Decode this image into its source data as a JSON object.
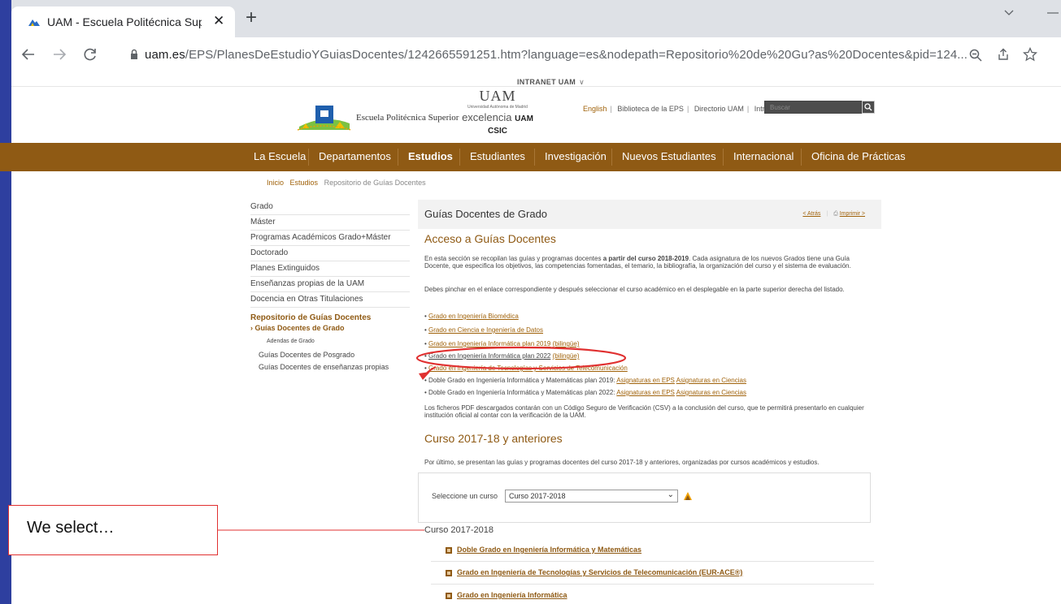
{
  "browser": {
    "tab_title": "UAM - Escuela Politécnica Superi",
    "tab_close": "✕",
    "new_tab": "+",
    "url_domain": "uam.es",
    "url_path": "/EPS/PlanesDeEstudioYGuiasDocentes/1242665591251.htm?language=es&nodepath=Repositorio%20de%20Gu?as%20Docentes&pid=124..."
  },
  "header": {
    "intranet": "INTRANET UAM",
    "eps_name": "Escuela Politécnica Superior",
    "uam": "UAM",
    "uam_sub": "Universidad Autónoma de Madrid",
    "excelencia": "excelencia",
    "excelencia_mark": "UAM CSIC",
    "links": [
      "English",
      "Biblioteca de la EPS",
      "Directorio UAM",
      "Intranet EPS"
    ],
    "search_placeholder": "Buscar"
  },
  "nav": [
    "La Escuela",
    "Departamentos",
    "Estudios",
    "Estudiantes",
    "Investigación",
    "Nuevos Estudiantes",
    "Internacional",
    "Oficina de Prácticas"
  ],
  "breadcrumb": [
    "Inicio",
    "Estudios",
    "Repositorio de Guías Docentes"
  ],
  "sidebar": {
    "items": [
      "Grado",
      "Máster",
      "Programas Académicos Grado+Máster",
      "Doctorado",
      "Planes Extinguidos",
      "Enseñanzas propias de la UAM",
      "Docencia en Otras Titulaciones"
    ],
    "section": "Repositorio de Guías Docentes",
    "sub_active": "› Guías Docentes de Grado",
    "sub_sub": "Adendas de Grado",
    "sub_items": [
      "Guías Docentes de Posgrado",
      "Guías Docentes de enseñanzas propias"
    ]
  },
  "main": {
    "title": "Guías Docentes de Grado",
    "back": "< Atrás",
    "print": "Imprimir >",
    "h_access": "Acceso a Guías Docentes",
    "p1_a": "En esta sección se recopilan las guías y programas docentes ",
    "p1_b": "a partir del curso 2018-2019",
    "p1_c": ". Cada asignatura de los nuevos Grados tiene una Guía Docente, que especifica los objetivos, las competencias fomentadas, el temario, la bibliografía, la organización del curso y el sistema de evaluación.",
    "p2": "Debes pinchar en el enlace correspondiente y después seleccionar el curso académico en el desplegable en la parte superior derecha del listado.",
    "links": [
      {
        "text": "Grado en Ingeniería Biomédica",
        "extra": ""
      },
      {
        "text": "Grado en Ciencia e Ingeniería de Datos",
        "extra": ""
      },
      {
        "text": "Grado en Ingeniería Informática plan 2019",
        "extra": "(bilingüe)"
      },
      {
        "text": "Grado en Ingeniería Informática plan 2022",
        "extra": "(bilingüe)"
      },
      {
        "text": "Grado en Ingeniería de Tecnologías y Servicios de Telecomunicación",
        "extra": ""
      }
    ],
    "doble": [
      {
        "text": "Doble Grado en Ingeniería Informática y Matemáticas plan 2019: ",
        "l1": "Asignaturas en EPS",
        "l2": "Asignaturas en Ciencias"
      },
      {
        "text": "Doble Grado en Ingeniería Informática y Matemáticas plan 2022: ",
        "l1": "Asignaturas en EPS",
        "l2": "Asignaturas en Ciencias"
      }
    ],
    "p3": "Los ficheros PDF descargados contarán con un Código Seguro de Verificación (CSV) a la conclusión del curso, que te permitirá presentarlo en cualquier institución oficial al contar con la verificación de la UAM.",
    "h_old": "Curso 2017-18 y anteriores",
    "p4": "Por último, se presentan las guías y programas docentes del curso 2017-18 y anteriores, organizadas por cursos académicos y estudios.",
    "select_label": "Seleccione un curso",
    "select_value": "Curso 2017-2018",
    "curso_label": "Curso 2017-2018",
    "accordion": [
      "Doble Grado en Ingeniería Informática y Matemáticas",
      "Grado en Ingeniería de Tecnologías y Servicios de Telecomunicación (EUR-ACE®)",
      "Grado en Ingeniería Informática"
    ]
  },
  "annotation": {
    "callout": "We select…",
    "color": "#e03030"
  },
  "colors": {
    "brand_brown": "#8f5a14",
    "link": "#a0620a",
    "chrome_tab_strip": "#dee1e6"
  }
}
